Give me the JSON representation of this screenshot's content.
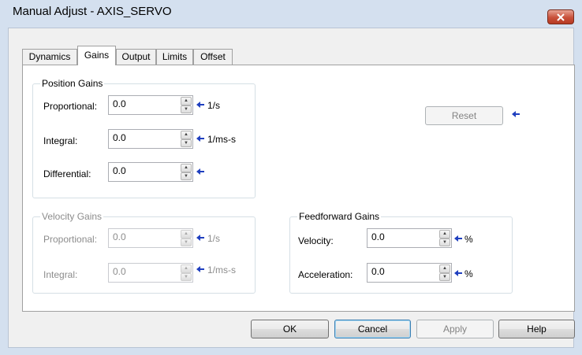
{
  "window": {
    "title": "Manual Adjust - AXIS_SERVO"
  },
  "tabs": [
    {
      "label": "Dynamics"
    },
    {
      "label": "Gains"
    },
    {
      "label": "Output"
    },
    {
      "label": "Limits"
    },
    {
      "label": "Offset"
    }
  ],
  "active_tab": "Gains",
  "position_gains": {
    "title": "Position Gains",
    "proportional": {
      "label": "Proportional:",
      "value": "0.0",
      "unit": "1/s"
    },
    "integral": {
      "label": "Integral:",
      "value": "0.0",
      "unit": "1/ms-s"
    },
    "differential": {
      "label": "Differential:",
      "value": "0.0",
      "unit": ""
    }
  },
  "velocity_gains": {
    "title": "Velocity Gains",
    "proportional": {
      "label": "Proportional:",
      "value": "0.0",
      "unit": "1/s"
    },
    "integral": {
      "label": "Integral:",
      "value": "0.0",
      "unit": "1/ms-s"
    }
  },
  "feedforward_gains": {
    "title": "Feedforward Gains",
    "velocity": {
      "label": "Velocity:",
      "value": "0.0",
      "unit": "%"
    },
    "acceleration": {
      "label": "Acceleration:",
      "value": "0.0",
      "unit": "%"
    }
  },
  "reset_label": "Reset",
  "footer": {
    "ok": "OK",
    "cancel": "Cancel",
    "apply": "Apply",
    "help": "Help"
  },
  "colors": {
    "arrow": "#1f3fbf",
    "title_bar": "#d4e0ef",
    "close": "#c8503a"
  },
  "icons": {
    "close": "close-icon",
    "pending": "left-arrow-icon",
    "spin_up": "spin-up-icon",
    "spin_down": "spin-down-icon"
  }
}
